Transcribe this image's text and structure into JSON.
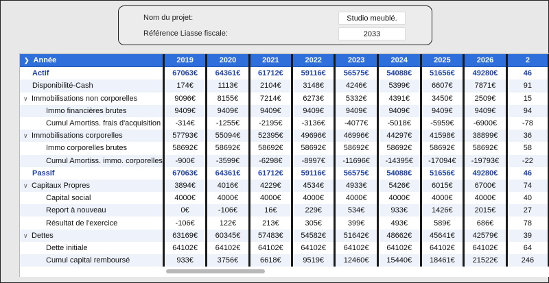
{
  "project": {
    "name_label": "Nom du projet:",
    "name_value": "Studio meublé.",
    "ref_label": "Référence Liasse fiscale:",
    "ref_value": "2033"
  },
  "table": {
    "header_label": "Année",
    "years": [
      "2019",
      "2020",
      "2021",
      "2022",
      "2023",
      "2024",
      "2025",
      "2026",
      "2"
    ],
    "rows": [
      {
        "label": "Actif",
        "values": [
          "67063€",
          "64361€",
          "61712€",
          "59116€",
          "56575€",
          "54088€",
          "51656€",
          "49280€",
          "46"
        ]
      },
      {
        "label": "Disponibilité-Cash",
        "values": [
          "174€",
          "1113€",
          "2104€",
          "3148€",
          "4246€",
          "5399€",
          "6607€",
          "7871€",
          "91"
        ]
      },
      {
        "label": "Immobilisations non corporelles",
        "values": [
          "9096€",
          "8155€",
          "7214€",
          "6273€",
          "5332€",
          "4391€",
          "3450€",
          "2509€",
          "15"
        ]
      },
      {
        "label": "Immo financières brutes",
        "values": [
          "9409€",
          "9409€",
          "9409€",
          "9409€",
          "9409€",
          "9409€",
          "9409€",
          "9409€",
          "94"
        ]
      },
      {
        "label": "Cumul Amortiss. frais d'acquisition",
        "values": [
          "-314€",
          "-1255€",
          "-2195€",
          "-3136€",
          "-4077€",
          "-5018€",
          "-5959€",
          "-6900€",
          "-78"
        ]
      },
      {
        "label": "Immobilisations corporelles",
        "values": [
          "57793€",
          "55094€",
          "52395€",
          "49696€",
          "46996€",
          "44297€",
          "41598€",
          "38899€",
          "36"
        ]
      },
      {
        "label": "Immo corporelles brutes",
        "values": [
          "58692€",
          "58692€",
          "58692€",
          "58692€",
          "58692€",
          "58692€",
          "58692€",
          "58692€",
          "58"
        ]
      },
      {
        "label": "Cumul Amortiss. immo. corporelles",
        "values": [
          "-900€",
          "-3599€",
          "-6298€",
          "-8997€",
          "-11696€",
          "-14395€",
          "-17094€",
          "-19793€",
          "-22"
        ]
      },
      {
        "label": "Passif",
        "values": [
          "67063€",
          "64361€",
          "61712€",
          "59116€",
          "56575€",
          "54088€",
          "51656€",
          "49280€",
          "46"
        ]
      },
      {
        "label": "Capitaux Propres",
        "values": [
          "3894€",
          "4016€",
          "4229€",
          "4534€",
          "4933€",
          "5426€",
          "6015€",
          "6700€",
          "74"
        ]
      },
      {
        "label": "Capital social",
        "values": [
          "4000€",
          "4000€",
          "4000€",
          "4000€",
          "4000€",
          "4000€",
          "4000€",
          "4000€",
          "40"
        ]
      },
      {
        "label": "Report à nouveau",
        "values": [
          "0€",
          "-106€",
          "16€",
          "229€",
          "534€",
          "933€",
          "1426€",
          "2015€",
          "27"
        ]
      },
      {
        "label": "Résultat de l'exercice",
        "values": [
          "-106€",
          "122€",
          "213€",
          "305€",
          "399€",
          "493€",
          "589€",
          "686€",
          "78"
        ]
      },
      {
        "label": "Dettes",
        "values": [
          "63169€",
          "60345€",
          "57483€",
          "54582€",
          "51642€",
          "48662€",
          "45641€",
          "42579€",
          "39"
        ]
      },
      {
        "label": "Dette initiale",
        "values": [
          "64102€",
          "64102€",
          "64102€",
          "64102€",
          "64102€",
          "64102€",
          "64102€",
          "64102€",
          "64"
        ]
      },
      {
        "label": "Cumul capital remboursé",
        "values": [
          "933€",
          "3756€",
          "6618€",
          "9519€",
          "12460€",
          "15440€",
          "18461€",
          "21522€",
          "246"
        ]
      }
    ]
  }
}
